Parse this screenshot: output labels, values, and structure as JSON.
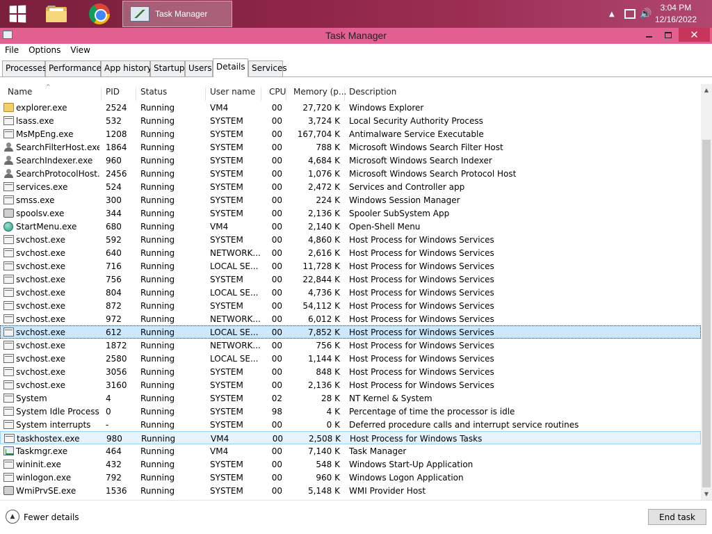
{
  "taskbar": {
    "task_label": "Task Manager",
    "clock_time": "3:04 PM",
    "clock_date": "12/16/2022"
  },
  "window": {
    "title": "Task Manager",
    "close_glyph": "✕"
  },
  "menu": [
    "File",
    "Options",
    "View"
  ],
  "tabs": [
    "Processes",
    "Performance",
    "App history",
    "Startup",
    "Users",
    "Details",
    "Services"
  ],
  "active_tab": "Details",
  "columns": {
    "name": "Name",
    "pid": "PID",
    "status": "Status",
    "user": "User name",
    "cpu": "CPU",
    "memory": "Memory (p...",
    "description": "Description"
  },
  "rows": [
    {
      "icon": "folder",
      "name": "explorer.exe",
      "pid": "2524",
      "status": "Running",
      "user": "VM4",
      "cpu": "00",
      "memory": "27,720 K",
      "description": "Windows Explorer"
    },
    {
      "icon": "exe",
      "name": "lsass.exe",
      "pid": "532",
      "status": "Running",
      "user": "SYSTEM",
      "cpu": "00",
      "memory": "3,724 K",
      "description": "Local Security Authority Process"
    },
    {
      "icon": "exe",
      "name": "MsMpEng.exe",
      "pid": "1208",
      "status": "Running",
      "user": "SYSTEM",
      "cpu": "00",
      "memory": "167,704 K",
      "description": "Antimalware Service Executable"
    },
    {
      "icon": "person",
      "name": "SearchFilterHost.exe",
      "pid": "1864",
      "status": "Running",
      "user": "SYSTEM",
      "cpu": "00",
      "memory": "788 K",
      "description": "Microsoft Windows Search Filter Host"
    },
    {
      "icon": "person",
      "name": "SearchIndexer.exe",
      "pid": "960",
      "status": "Running",
      "user": "SYSTEM",
      "cpu": "00",
      "memory": "4,684 K",
      "description": "Microsoft Windows Search Indexer"
    },
    {
      "icon": "person",
      "name": "SearchProtocolHost....",
      "pid": "2456",
      "status": "Running",
      "user": "SYSTEM",
      "cpu": "00",
      "memory": "1,076 K",
      "description": "Microsoft Windows Search Protocol Host"
    },
    {
      "icon": "exe",
      "name": "services.exe",
      "pid": "524",
      "status": "Running",
      "user": "SYSTEM",
      "cpu": "00",
      "memory": "2,472 K",
      "description": "Services and Controller app"
    },
    {
      "icon": "exe",
      "name": "smss.exe",
      "pid": "300",
      "status": "Running",
      "user": "SYSTEM",
      "cpu": "00",
      "memory": "224 K",
      "description": "Windows Session Manager"
    },
    {
      "icon": "printer",
      "name": "spoolsv.exe",
      "pid": "344",
      "status": "Running",
      "user": "SYSTEM",
      "cpu": "00",
      "memory": "2,136 K",
      "description": "Spooler SubSystem App"
    },
    {
      "icon": "globe",
      "name": "StartMenu.exe",
      "pid": "680",
      "status": "Running",
      "user": "VM4",
      "cpu": "00",
      "memory": "2,140 K",
      "description": "Open-Shell Menu"
    },
    {
      "icon": "exe",
      "name": "svchost.exe",
      "pid": "592",
      "status": "Running",
      "user": "SYSTEM",
      "cpu": "00",
      "memory": "4,860 K",
      "description": "Host Process for Windows Services"
    },
    {
      "icon": "exe",
      "name": "svchost.exe",
      "pid": "640",
      "status": "Running",
      "user": "NETWORK...",
      "cpu": "00",
      "memory": "2,616 K",
      "description": "Host Process for Windows Services"
    },
    {
      "icon": "exe",
      "name": "svchost.exe",
      "pid": "716",
      "status": "Running",
      "user": "LOCAL SE...",
      "cpu": "00",
      "memory": "11,728 K",
      "description": "Host Process for Windows Services"
    },
    {
      "icon": "exe",
      "name": "svchost.exe",
      "pid": "756",
      "status": "Running",
      "user": "SYSTEM",
      "cpu": "00",
      "memory": "22,844 K",
      "description": "Host Process for Windows Services"
    },
    {
      "icon": "exe",
      "name": "svchost.exe",
      "pid": "804",
      "status": "Running",
      "user": "LOCAL SE...",
      "cpu": "00",
      "memory": "4,736 K",
      "description": "Host Process for Windows Services"
    },
    {
      "icon": "exe",
      "name": "svchost.exe",
      "pid": "872",
      "status": "Running",
      "user": "SYSTEM",
      "cpu": "00",
      "memory": "54,112 K",
      "description": "Host Process for Windows Services"
    },
    {
      "icon": "exe",
      "name": "svchost.exe",
      "pid": "972",
      "status": "Running",
      "user": "NETWORK...",
      "cpu": "00",
      "memory": "6,012 K",
      "description": "Host Process for Windows Services"
    },
    {
      "icon": "exe",
      "name": "svchost.exe",
      "pid": "612",
      "status": "Running",
      "user": "LOCAL SE...",
      "cpu": "00",
      "memory": "7,852 K",
      "description": "Host Process for Windows Services",
      "state": "selected"
    },
    {
      "icon": "exe",
      "name": "svchost.exe",
      "pid": "1872",
      "status": "Running",
      "user": "NETWORK...",
      "cpu": "00",
      "memory": "756 K",
      "description": "Host Process for Windows Services"
    },
    {
      "icon": "exe",
      "name": "svchost.exe",
      "pid": "2580",
      "status": "Running",
      "user": "LOCAL SE...",
      "cpu": "00",
      "memory": "1,144 K",
      "description": "Host Process for Windows Services"
    },
    {
      "icon": "exe",
      "name": "svchost.exe",
      "pid": "3056",
      "status": "Running",
      "user": "SYSTEM",
      "cpu": "00",
      "memory": "848 K",
      "description": "Host Process for Windows Services"
    },
    {
      "icon": "exe",
      "name": "svchost.exe",
      "pid": "3160",
      "status": "Running",
      "user": "SYSTEM",
      "cpu": "00",
      "memory": "2,136 K",
      "description": "Host Process for Windows Services"
    },
    {
      "icon": "exe",
      "name": "System",
      "pid": "4",
      "status": "Running",
      "user": "SYSTEM",
      "cpu": "02",
      "memory": "28 K",
      "description": "NT Kernel & System"
    },
    {
      "icon": "exe",
      "name": "System Idle Process",
      "pid": "0",
      "status": "Running",
      "user": "SYSTEM",
      "cpu": "98",
      "memory": "4 K",
      "description": "Percentage of time the processor is idle"
    },
    {
      "icon": "exe",
      "name": "System interrupts",
      "pid": "-",
      "status": "Running",
      "user": "SYSTEM",
      "cpu": "00",
      "memory": "0 K",
      "description": "Deferred procedure calls and interrupt service routines"
    },
    {
      "icon": "exe",
      "name": "taskhostex.exe",
      "pid": "980",
      "status": "Running",
      "user": "VM4",
      "cpu": "00",
      "memory": "2,508 K",
      "description": "Host Process for Windows Tasks",
      "state": "hover"
    },
    {
      "icon": "tm",
      "name": "Taskmgr.exe",
      "pid": "464",
      "status": "Running",
      "user": "VM4",
      "cpu": "00",
      "memory": "7,140 K",
      "description": "Task Manager"
    },
    {
      "icon": "exe",
      "name": "wininit.exe",
      "pid": "432",
      "status": "Running",
      "user": "SYSTEM",
      "cpu": "00",
      "memory": "548 K",
      "description": "Windows Start-Up Application"
    },
    {
      "icon": "exe",
      "name": "winlogon.exe",
      "pid": "792",
      "status": "Running",
      "user": "SYSTEM",
      "cpu": "00",
      "memory": "960 K",
      "description": "Windows Logon Application"
    },
    {
      "icon": "printer",
      "name": "WmiPrvSE.exe",
      "pid": "1536",
      "status": "Running",
      "user": "SYSTEM",
      "cpu": "00",
      "memory": "5,148 K",
      "description": "WMI Provider Host"
    }
  ],
  "footer": {
    "fewer_details": "Fewer details",
    "end_task": "End task"
  },
  "colors": {
    "taskbar": "#8a2446",
    "titlebar": "#e1608f",
    "close_button": "#c7355b",
    "selected_row": "#cce8ff"
  }
}
